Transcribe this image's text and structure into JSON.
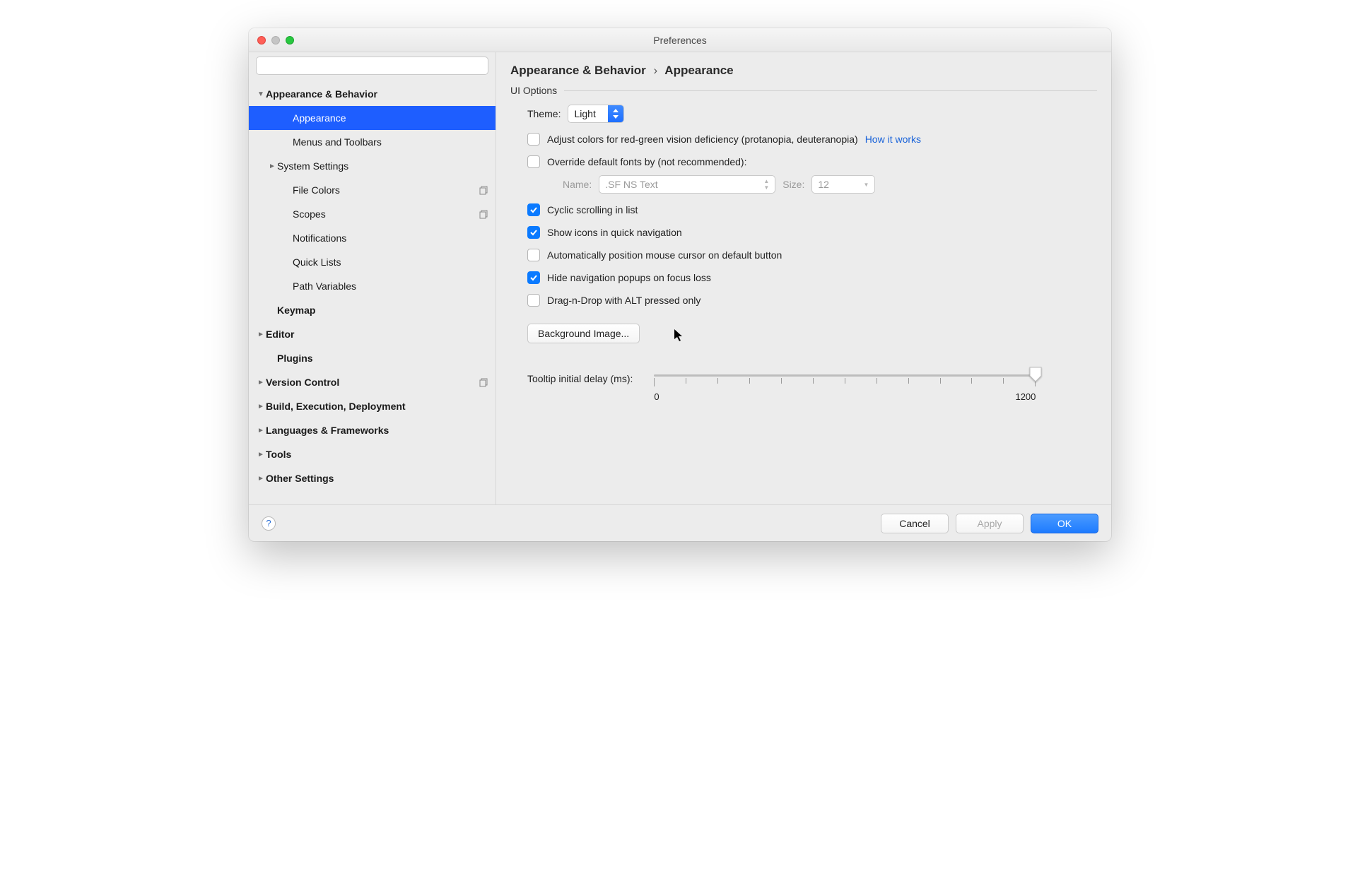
{
  "window": {
    "title": "Preferences"
  },
  "sidebar": {
    "search_placeholder": "",
    "items": [
      {
        "label": "Appearance & Behavior",
        "depth": 0,
        "bold": true,
        "arrow": "down"
      },
      {
        "label": "Appearance",
        "depth": 2,
        "selected": true
      },
      {
        "label": "Menus and Toolbars",
        "depth": 2
      },
      {
        "label": "System Settings",
        "depth": 1,
        "arrow": "right"
      },
      {
        "label": "File Colors",
        "depth": 2,
        "trailing": "copy"
      },
      {
        "label": "Scopes",
        "depth": 2,
        "trailing": "copy"
      },
      {
        "label": "Notifications",
        "depth": 2
      },
      {
        "label": "Quick Lists",
        "depth": 2
      },
      {
        "label": "Path Variables",
        "depth": 2
      },
      {
        "label": "Keymap",
        "depth": 1,
        "bold": true
      },
      {
        "label": "Editor",
        "depth": 0,
        "bold": true,
        "arrow": "right"
      },
      {
        "label": "Plugins",
        "depth": 1,
        "bold": true
      },
      {
        "label": "Version Control",
        "depth": 0,
        "bold": true,
        "arrow": "right",
        "trailing": "copy"
      },
      {
        "label": "Build, Execution, Deployment",
        "depth": 0,
        "bold": true,
        "arrow": "right"
      },
      {
        "label": "Languages & Frameworks",
        "depth": 0,
        "bold": true,
        "arrow": "right"
      },
      {
        "label": "Tools",
        "depth": 0,
        "bold": true,
        "arrow": "right"
      },
      {
        "label": "Other Settings",
        "depth": 0,
        "bold": true,
        "arrow": "right"
      }
    ]
  },
  "breadcrumb": {
    "parent": "Appearance & Behavior",
    "current": "Appearance"
  },
  "section": {
    "title": "UI Options"
  },
  "theme": {
    "label": "Theme:",
    "value": "Light"
  },
  "checks": {
    "adjust_colors": {
      "label": "Adjust colors for red-green vision deficiency (protanopia, deuteranopia)",
      "checked": false,
      "link": "How it works"
    },
    "override_fonts": {
      "label": "Override default fonts by (not recommended):",
      "checked": false
    },
    "cyclic": {
      "label": "Cyclic scrolling in list",
      "checked": true
    },
    "show_icons": {
      "label": "Show icons in quick navigation",
      "checked": true
    },
    "auto_mouse": {
      "label": "Automatically position mouse cursor on default button",
      "checked": false
    },
    "hide_popups": {
      "label": "Hide navigation popups on focus loss",
      "checked": true
    },
    "drag_alt": {
      "label": "Drag-n-Drop with ALT pressed only",
      "checked": false
    }
  },
  "font": {
    "name_label": "Name:",
    "name_value": ".SF NS Text",
    "size_label": "Size:",
    "size_value": "12"
  },
  "bg_button": "Background Image...",
  "tooltip": {
    "label": "Tooltip initial delay (ms):",
    "min": "0",
    "max": "1200"
  },
  "footer": {
    "cancel": "Cancel",
    "apply": "Apply",
    "ok": "OK"
  }
}
